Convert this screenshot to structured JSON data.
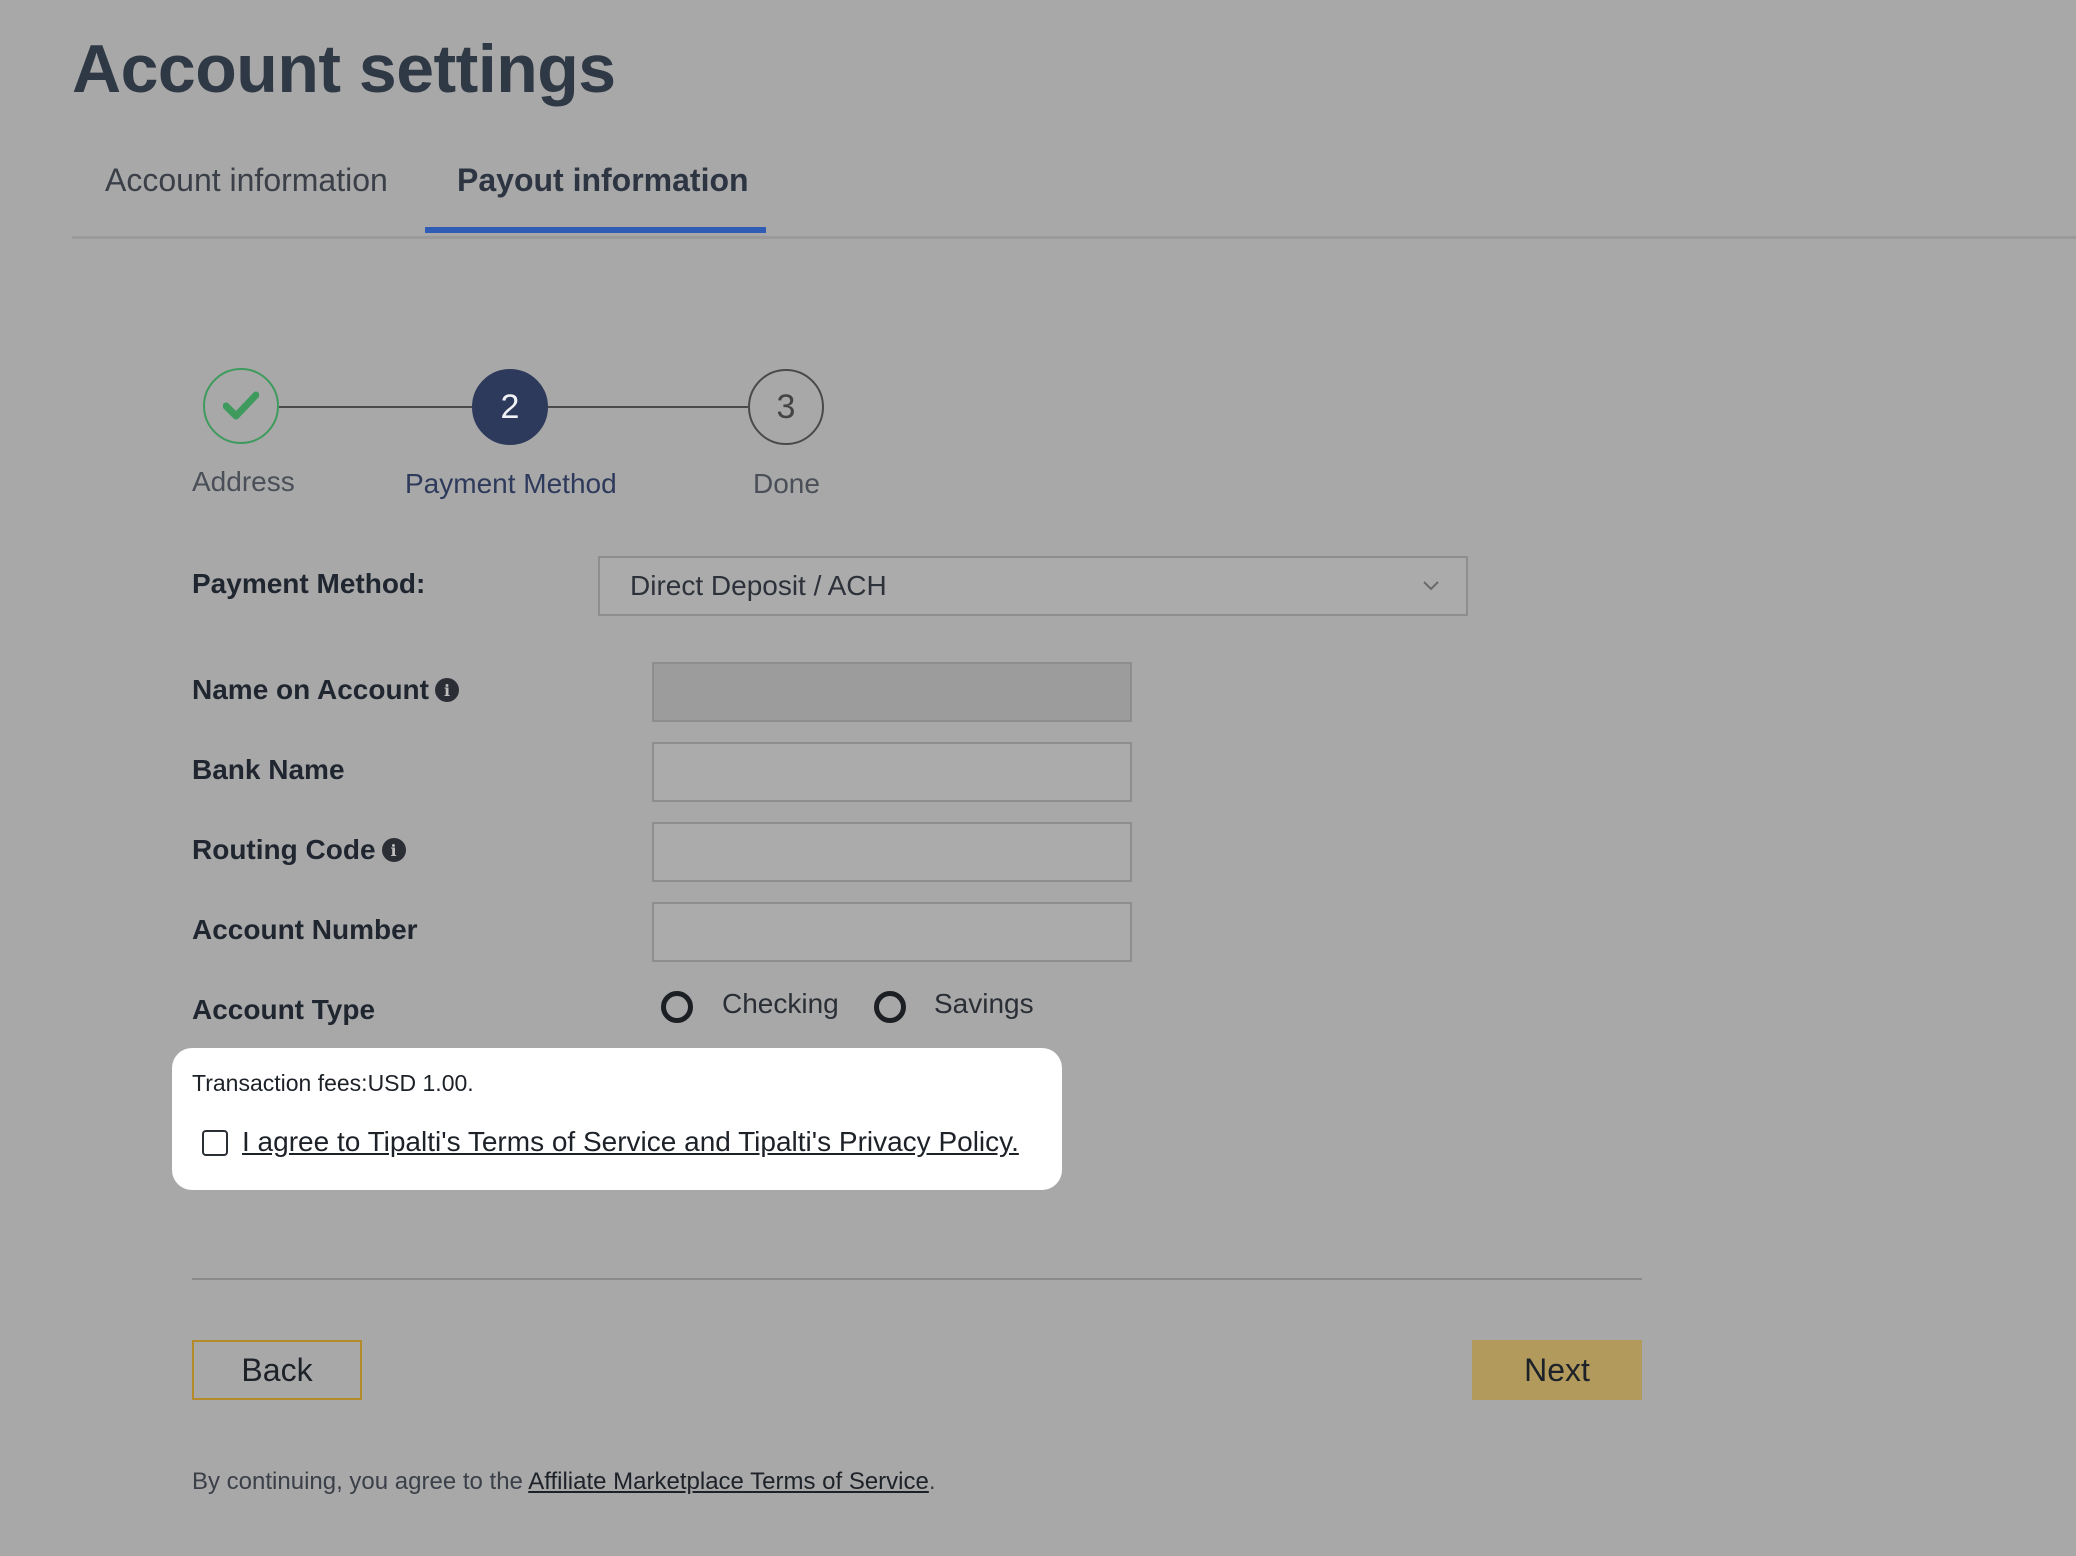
{
  "page": {
    "title": "Account settings"
  },
  "tabs": [
    {
      "label": "Account information",
      "active": false
    },
    {
      "label": "Payout information",
      "active": true
    }
  ],
  "stepper": {
    "steps": [
      {
        "number": "1",
        "label": "Address",
        "state": "complete",
        "icon": "checkmark-icon"
      },
      {
        "number": "2",
        "label": "Payment Method",
        "state": "current"
      },
      {
        "number": "3",
        "label": "Done",
        "state": "pending"
      }
    ]
  },
  "form": {
    "payment_method_label": "Payment Method:",
    "payment_method_value": "Direct Deposit / ACH",
    "name_on_account_label": "Name on Account",
    "bank_name_label": "Bank Name",
    "routing_code_label": "Routing Code",
    "account_number_label": "Account Number",
    "account_type_label": "Account Type",
    "account_type_options": [
      "Checking",
      "Savings"
    ]
  },
  "fees": {
    "text": "Transaction fees:USD 1.00.",
    "agree_text": "I agree to Tipalti's Terms of Service and Tipalti's Privacy Policy."
  },
  "buttons": {
    "back": "Back",
    "next": "Next"
  },
  "footer": {
    "prefix": "By continuing, you agree to the ",
    "link": "Affiliate Marketplace Terms of Service",
    "suffix": "."
  },
  "colors": {
    "background": "#a8a8a8",
    "tab_underline": "#2f5cb5",
    "step_complete": "#3f9a5e",
    "step_current": "#2e3a5c",
    "next_button": "#b19a5c",
    "back_border": "#b58a2a"
  }
}
